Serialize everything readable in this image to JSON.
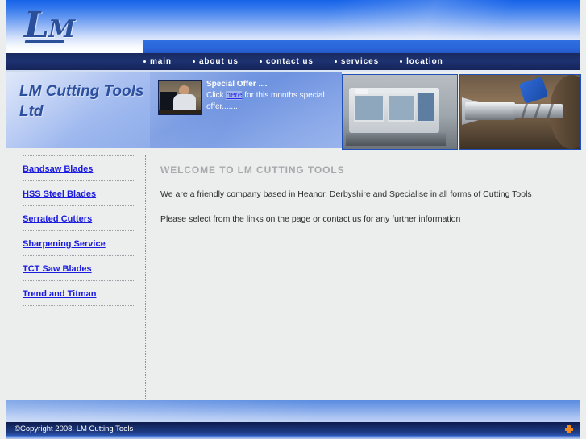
{
  "site": {
    "logo_text_l": "L",
    "logo_text_m": "M",
    "company_name": "LM Cutting Tools Ltd"
  },
  "nav": {
    "items": [
      {
        "label": "main"
      },
      {
        "label": "about us"
      },
      {
        "label": "contact us"
      },
      {
        "label": "services"
      },
      {
        "label": "location"
      }
    ]
  },
  "banner": {
    "offer": {
      "title": "Special Offer ....",
      "text_before": "Click ",
      "link": "here",
      "text_after": " for this months special offer......."
    },
    "photo_machine_alt": "cnc-grinding-machine-photo",
    "photo_tool_alt": "cutting-tool-closeup-photo",
    "offer_photo_alt": "man-at-computer-photo"
  },
  "sidebar": {
    "items": [
      {
        "label": "Bandsaw Blades"
      },
      {
        "label": "HSS Steel Blades"
      },
      {
        "label": "Serrated Cutters"
      },
      {
        "label": "Sharpening Service"
      },
      {
        "label": "TCT Saw Blades"
      },
      {
        "label": "Trend and Titman"
      }
    ]
  },
  "main": {
    "title": "WELCOME TO LM CUTTING TOOLS",
    "paragraph1": "We are a friendly company based in Heanor, Derbyshire and Specialise in all forms of Cutting Tools",
    "paragraph2": "Please select from the links on the page or contact us for any further information"
  },
  "footer": {
    "copyright": "©Copyright 2008. LM Cutting Tools",
    "mark": "orange-cross-mark"
  },
  "colors": {
    "nav_bg": "#1d3272",
    "accent_blue": "#2a67da",
    "link_blue": "#1a1ae0",
    "title_gray": "#a6a9ab",
    "page_bg": "#eceded",
    "orange": "#f08820"
  }
}
